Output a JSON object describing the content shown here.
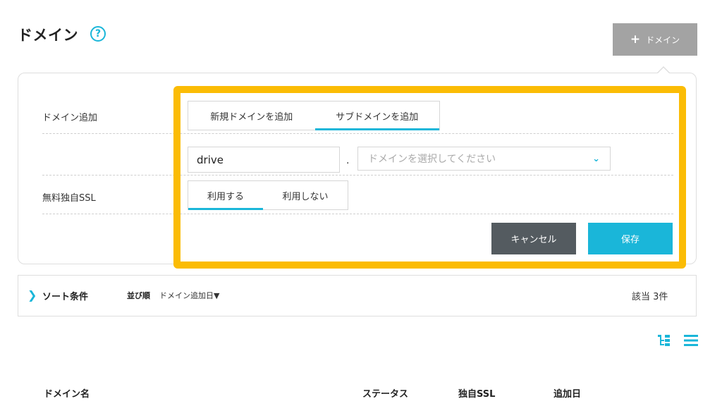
{
  "header": {
    "title": "ドメイン",
    "help_icon": "help-circle-icon",
    "help_glyph": "?",
    "add_button": {
      "icon": "plus-icon",
      "glyph": "+",
      "label": "ドメイン"
    }
  },
  "form": {
    "domain_add_label": "ドメイン追加",
    "domain_tabs": [
      {
        "label": "新規ドメインを追加",
        "active": false
      },
      {
        "label": "サブドメインを追加",
        "active": true
      }
    ],
    "subdomain_value": "drive",
    "separator": ".",
    "domain_select": {
      "placeholder": "ドメインを選択してください",
      "icon": "chevron-down-icon",
      "glyph": "⌄"
    },
    "ssl_label": "無料独自SSL",
    "ssl_tabs": [
      {
        "label": "利用する",
        "active": true
      },
      {
        "label": "利用しない",
        "active": false
      }
    ],
    "cancel_label": "キャンセル",
    "save_label": "保存"
  },
  "colors": {
    "accent": "#1ab6d9",
    "highlight": "#fbbc05",
    "cancel": "#545b60",
    "add_button": "#a3a3a3"
  },
  "sort": {
    "chevron_glyph": "❯",
    "title": "ソート条件",
    "order_label": "並び順",
    "order_value": "ドメイン追加日▼",
    "result_count": "該当 3件"
  },
  "view_toggle": {
    "tree_icon": "tree-view-icon",
    "list_icon": "list-view-icon"
  },
  "table": {
    "columns": [
      "ドメイン名",
      "ステータス",
      "独自SSL",
      "追加日"
    ]
  }
}
